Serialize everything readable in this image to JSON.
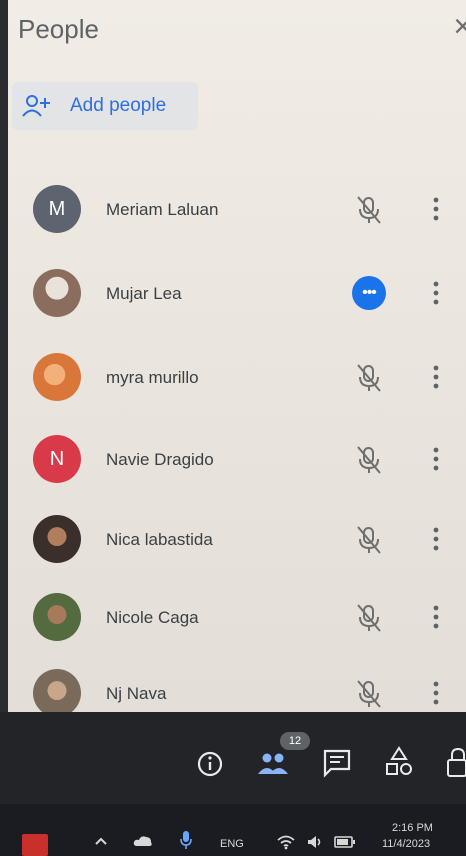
{
  "panel": {
    "title": "People",
    "close_label": "×",
    "add_people_label": "Add people"
  },
  "participants": [
    {
      "name": "Meriam Laluan",
      "initial": "M",
      "avatar_color": "#5d6470",
      "status": "muted"
    },
    {
      "name": "Mujar Lea",
      "initial": "",
      "avatar_color": "#8b6d5e",
      "status": "more-options"
    },
    {
      "name": "myra murillo",
      "initial": "",
      "avatar_color": "#d9773a",
      "status": "muted"
    },
    {
      "name": "Navie Dragido",
      "initial": "N",
      "avatar_color": "#d93a4a",
      "status": "muted"
    },
    {
      "name": "Nica labastida",
      "initial": "",
      "avatar_color": "#3b2f2c",
      "status": "muted"
    },
    {
      "name": "Nicole Caga",
      "initial": "",
      "avatar_color": "#536b3f",
      "status": "muted"
    },
    {
      "name": "Nj Nava",
      "initial": "",
      "avatar_color": "#7a6a5a",
      "status": "muted"
    }
  ],
  "toolbar": {
    "people_count": "12",
    "icons": [
      "info-icon",
      "people-icon",
      "chat-icon",
      "activities-icon",
      "lock-icon"
    ],
    "accent": "#8ab4f8"
  },
  "taskbar": {
    "language": "ENG",
    "time": "2:16 PM",
    "date": "11/4/2023"
  }
}
